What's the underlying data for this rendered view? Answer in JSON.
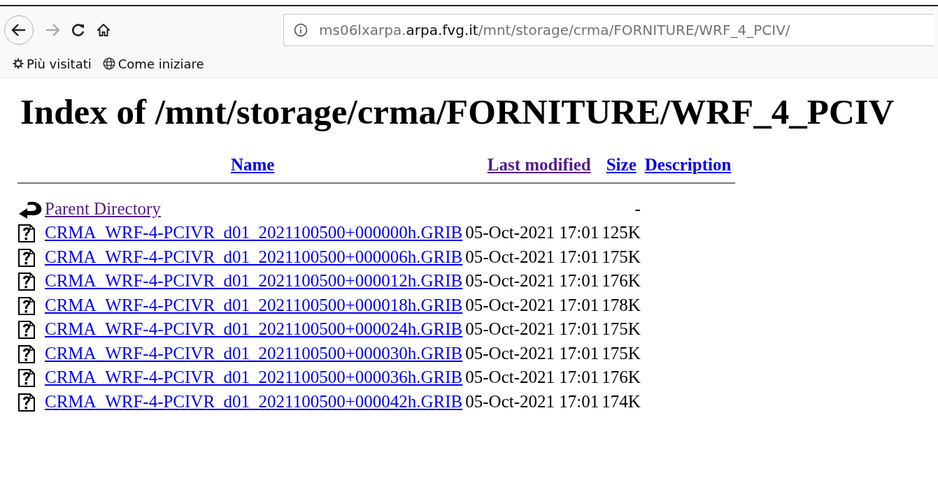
{
  "browser": {
    "url": {
      "subdomain": "ms06lxarpa.",
      "domain": "arpa.fvg.it",
      "path": "/mnt/storage/crma/FORNITURE/WRF_4_PCIV/"
    },
    "forward_enabled": false,
    "bookmarks": [
      {
        "label": "Più visitati",
        "kind": "gear"
      },
      {
        "label": "Come iniziare",
        "kind": "globe"
      }
    ]
  },
  "heading": "Index of /mnt/storage/crma/FORNITURE/WRF_4_PCIV",
  "table": {
    "columns": [
      {
        "label": "Name",
        "visited": false
      },
      {
        "label": "Last modified",
        "visited": true
      },
      {
        "label": "Size",
        "visited": false
      },
      {
        "label": "Description",
        "visited": false
      }
    ],
    "rows": [
      {
        "kind": "parent",
        "name": "Parent Directory",
        "visited": true,
        "modified": "",
        "size": "-"
      },
      {
        "kind": "file",
        "name": "CRMA_WRF-4-PCIVR_d01_2021100500+000000h.GRIB",
        "visited": false,
        "modified": "05-Oct-2021 17:01",
        "size": "125K"
      },
      {
        "kind": "file",
        "name": "CRMA_WRF-4-PCIVR_d01_2021100500+000006h.GRIB",
        "visited": false,
        "modified": "05-Oct-2021 17:01",
        "size": "175K"
      },
      {
        "kind": "file",
        "name": "CRMA_WRF-4-PCIVR_d01_2021100500+000012h.GRIB",
        "visited": false,
        "modified": "05-Oct-2021 17:01",
        "size": "176K"
      },
      {
        "kind": "file",
        "name": "CRMA_WRF-4-PCIVR_d01_2021100500+000018h.GRIB",
        "visited": false,
        "modified": "05-Oct-2021 17:01",
        "size": "178K"
      },
      {
        "kind": "file",
        "name": "CRMA_WRF-4-PCIVR_d01_2021100500+000024h.GRIB",
        "visited": false,
        "modified": "05-Oct-2021 17:01",
        "size": "175K"
      },
      {
        "kind": "file",
        "name": "CRMA_WRF-4-PCIVR_d01_2021100500+000030h.GRIB",
        "visited": false,
        "modified": "05-Oct-2021 17:01",
        "size": "175K"
      },
      {
        "kind": "file",
        "name": "CRMA_WRF-4-PCIVR_d01_2021100500+000036h.GRIB",
        "visited": false,
        "modified": "05-Oct-2021 17:01",
        "size": "176K"
      },
      {
        "kind": "file",
        "name": "CRMA_WRF-4-PCIVR_d01_2021100500+000042h.GRIB",
        "visited": false,
        "modified": "05-Oct-2021 17:01",
        "size": "174K"
      }
    ]
  }
}
